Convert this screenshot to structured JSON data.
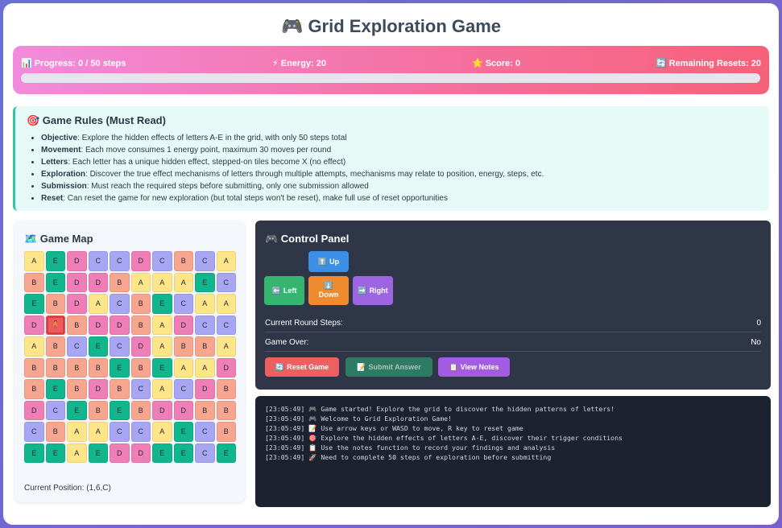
{
  "title": "🎮 Grid Exploration Game",
  "stats": {
    "progress_icon": "📊",
    "progress": "Progress: 0 / 50 steps",
    "energy_icon": "⚡",
    "energy": "Energy: 20",
    "score_icon": "⭐",
    "score": "Score: 0",
    "resets_icon": "🔄",
    "resets": "Remaining Resets: 20",
    "progress_fraction": 0
  },
  "rules": {
    "title": "🎯 Game Rules (Must Read)",
    "items": [
      {
        "label": "Objective",
        "text": ": Explore the hidden effects of letters A-E in the grid, with only 50 steps total"
      },
      {
        "label": "Movement",
        "text": ": Each move consumes 1 energy point, maximum 30 moves per round"
      },
      {
        "label": "Letters",
        "text": ": Each letter has a unique hidden effect, stepped-on tiles become X (no effect)"
      },
      {
        "label": "Exploration",
        "text": ": Discover the true effect mechanisms of letters through multiple attempts, mechanisms may relate to position, energy, steps, etc."
      },
      {
        "label": "Submission",
        "text": ": Must reach the required steps before submitting, only one submission allowed"
      },
      {
        "label": "Reset",
        "text": ": Can reset the game for new exploration (but total steps won't be reset), make full use of reset opportunities"
      }
    ]
  },
  "map": {
    "title": "🗺️ Game Map",
    "player_icon": "🧍",
    "player_row": 3,
    "player_col": 1,
    "grid": [
      [
        "A",
        "E",
        "D",
        "C",
        "C",
        "D",
        "C",
        "B",
        "C",
        "A"
      ],
      [
        "B",
        "E",
        "D",
        "D",
        "B",
        "A",
        "A",
        "A",
        "E",
        "C"
      ],
      [
        "E",
        "B",
        "D",
        "A",
        "C",
        "B",
        "E",
        "C",
        "A",
        "A"
      ],
      [
        "D",
        "C",
        "B",
        "D",
        "D",
        "B",
        "A",
        "D",
        "C",
        "C"
      ],
      [
        "A",
        "B",
        "C",
        "E",
        "C",
        "D",
        "A",
        "B",
        "B",
        "A"
      ],
      [
        "B",
        "B",
        "B",
        "B",
        "E",
        "B",
        "E",
        "A",
        "A",
        "D"
      ],
      [
        "B",
        "E",
        "B",
        "D",
        "B",
        "C",
        "A",
        "C",
        "D",
        "B"
      ],
      [
        "D",
        "C",
        "E",
        "B",
        "E",
        "B",
        "D",
        "D",
        "B",
        "B"
      ],
      [
        "C",
        "B",
        "A",
        "A",
        "C",
        "C",
        "A",
        "E",
        "C",
        "B"
      ],
      [
        "E",
        "E",
        "A",
        "E",
        "D",
        "D",
        "E",
        "E",
        "C",
        "E"
      ]
    ],
    "position": "Current Position: (1,6,C)"
  },
  "control": {
    "title": "🎮 Control Panel",
    "up_icon": "⬆️",
    "up": "Up",
    "left_icon": "⬅️",
    "left": "Left",
    "down_icon": "⬇️",
    "down": "Down",
    "right_icon": "➡️",
    "right": "Right",
    "steps_label": "Current Round Steps:",
    "steps_value": "0",
    "gameover_label": "Game Over:",
    "gameover_value": "No",
    "reset_icon": "🔄",
    "reset": "Reset Game",
    "submit_icon": "📝",
    "submit": "Submit Answer",
    "notes_icon": "📋",
    "notes": "View Notes"
  },
  "log": [
    "[23:05:49] 🎮 Game started! Explore the grid to discover the hidden patterns of letters!",
    "[23:05:49] 🎮 Welcome to Grid Exploration Game!",
    "[23:05:49] 📝 Use arrow keys or WASD to move, R key to reset game",
    "[23:05:49] 🎯 Explore the hidden effects of letters A-E, discover their trigger conditions",
    "[23:05:49] 📋 Use the notes function to record your findings and analysis",
    "[23:05:49] 🚀 Need to complete 50 steps of exploration before submitting"
  ]
}
